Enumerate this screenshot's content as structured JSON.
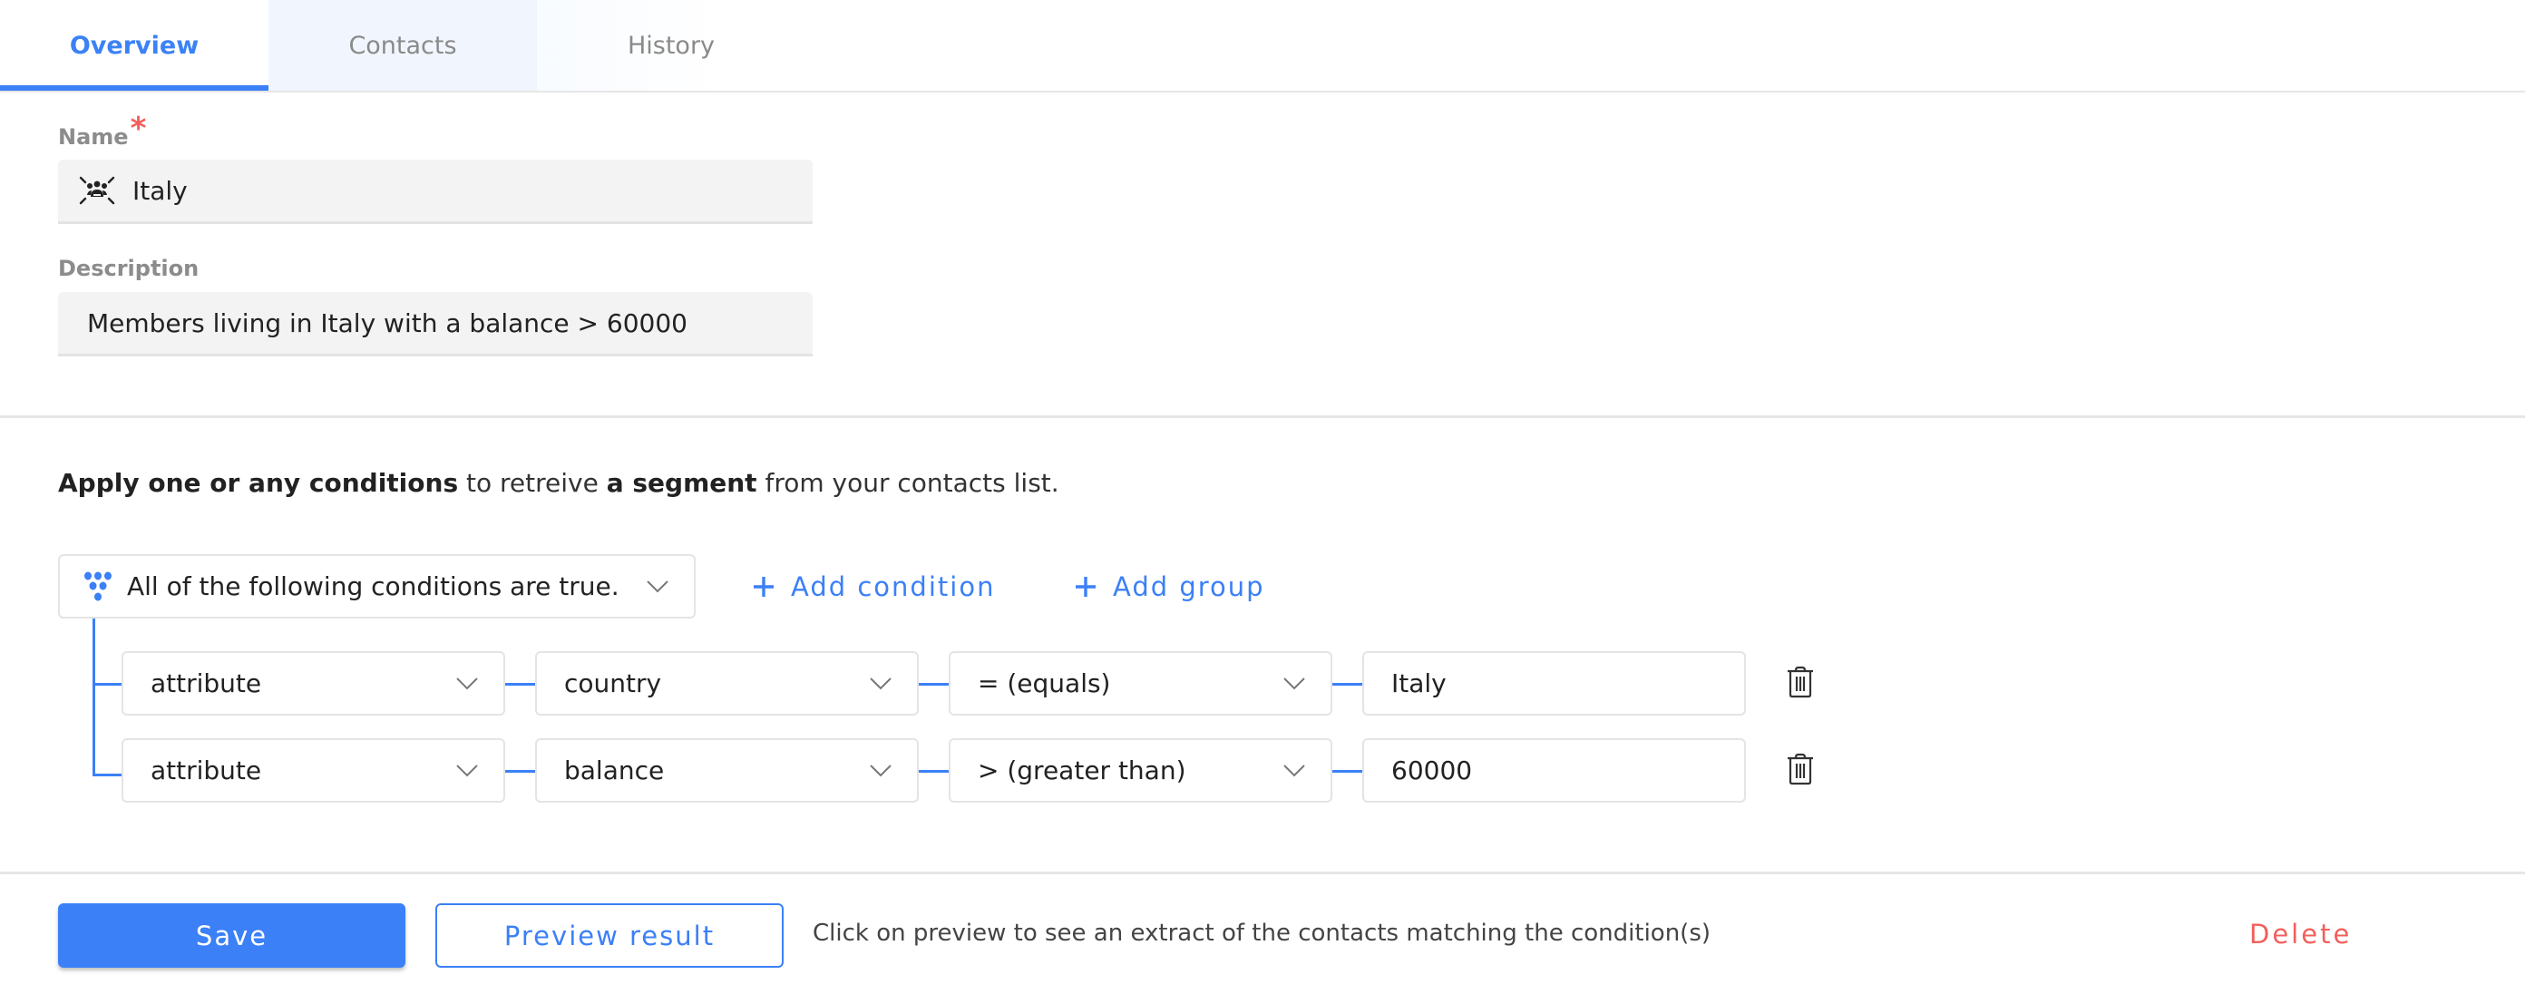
{
  "tabs": [
    {
      "label": "Overview",
      "active": true
    },
    {
      "label": "Contacts",
      "active": false
    },
    {
      "label": "History",
      "active": false
    }
  ],
  "form": {
    "name_label": "Name",
    "required_mark": "*",
    "name_icon": "group-people-icon",
    "name_value": "Italy",
    "description_label": "Description",
    "description_value": "Members living in Italy with a balance > 60000"
  },
  "conditions": {
    "intro": {
      "part1_bold": "Apply one or any conditions",
      "part2": " to retreive ",
      "part3_bold": "a segment",
      "part4": " from your contacts list."
    },
    "group_icon": "segment-dots-icon",
    "group_mode": "All of the following conditions are true.",
    "add_condition_label": "Add condition",
    "add_group_label": "Add group",
    "rows": [
      {
        "type": "attribute",
        "field": "country",
        "operator": "= (equals)",
        "value": "Italy"
      },
      {
        "type": "attribute",
        "field": "balance",
        "operator": "> (greater than)",
        "value": "60000"
      }
    ]
  },
  "footer": {
    "save_label": "Save",
    "preview_label": "Preview result",
    "help_text": "Click on preview to see an extract of the contacts matching the condition(s)",
    "delete_label": "Delete"
  },
  "colors": {
    "accent": "#3b80f7",
    "danger": "#f25f5c",
    "field_bg": "#f3f3f3",
    "label_gray": "#8c8c8c"
  }
}
